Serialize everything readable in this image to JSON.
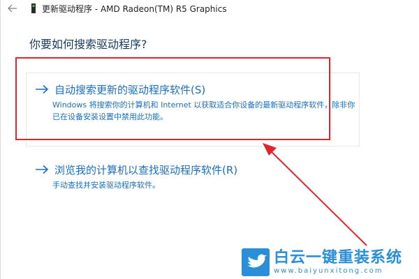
{
  "window": {
    "title": "更新驱动程序 - AMD Radeon(TM) R5 Graphics",
    "back_icon": "back-arrow-icon",
    "device_icon": "device-icon"
  },
  "main": {
    "question": "你要如何搜索驱动程序?",
    "options": [
      {
        "title": "自动搜索更新的驱动程序软件(S)",
        "description": "Windows 将搜索你的计算机和 Internet 以获取适合你设备的最新驱动程序软件，除非你已在设备安装设置中禁用此功能。",
        "icon": "arrow-right-icon"
      },
      {
        "title": "浏览我的计算机以查找驱动程序软件(R)",
        "description": "手动查找并安装驱动程序软件。",
        "icon": "arrow-right-icon"
      }
    ]
  },
  "annotation": {
    "highlight_color": "#e2242c",
    "accent_color": "#1a6fc4"
  },
  "watermark": {
    "brand": "白云一键重装系统",
    "url": "www.baiyunxitong.com",
    "logo_icon": "bird-logo-icon",
    "color": "#2a8fd8"
  }
}
